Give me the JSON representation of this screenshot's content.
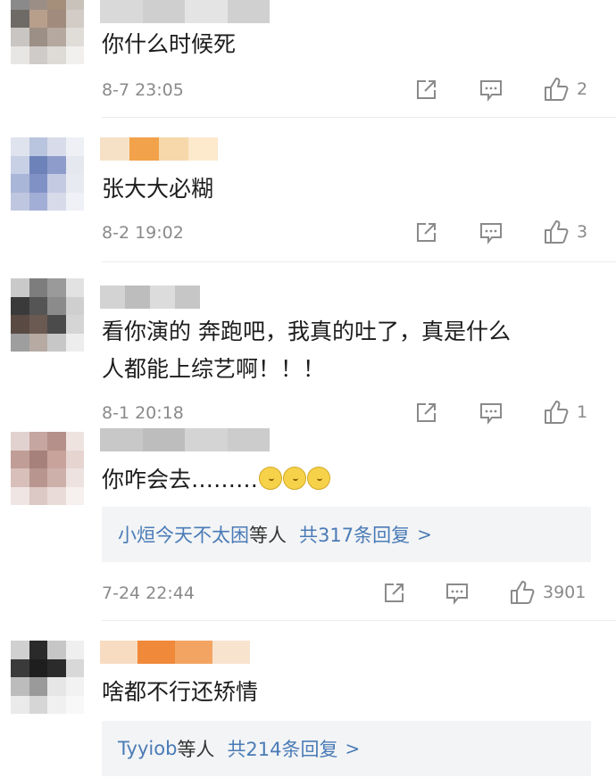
{
  "comments": [
    {
      "text": "你什么时候死",
      "time": "8-7 23:05",
      "likes": "2",
      "avatar_colors": [
        "#8a8a8a",
        "#9b8e86",
        "#a58f7a",
        "#c9c2bb",
        "#6e6a66",
        "#b89f8c",
        "#a08b7c",
        "#d3ccc6",
        "#c9c5c2",
        "#9c8f86",
        "#b5a89e",
        "#e0dcd8",
        "#e8e6e4",
        "#cfcbc8",
        "#dedad6",
        "#f2f0ee"
      ],
      "nick_colors": [
        "#d9d9d9",
        "#cfcfcf",
        "#e4e4e4",
        "#d0d0d0"
      ]
    },
    {
      "text": "张大大必糊",
      "time": "8-2 19:02",
      "likes": "3",
      "avatar_colors": [
        "#dfe3ee",
        "#b9c4de",
        "#d8dcea",
        "#eef0f6",
        "#c8d0e6",
        "#6d82b8",
        "#8e9ccc",
        "#e6e8f0",
        "#aab6d8",
        "#8091c5",
        "#c3cae2",
        "#e8eaf2",
        "#bfc6df",
        "#a3aed6",
        "#d6dae9",
        "#eff1f6"
      ],
      "nick_colors": [
        "#f6e1c6",
        "#f2a24a",
        "#f7d8aa",
        "#fde9cc"
      ]
    },
    {
      "text_lines": [
        "看你演的 奔跑吧，我真的吐了，真是什么",
        "人都能上综艺啊！！！"
      ],
      "time": "8-1 20:18",
      "likes": "1",
      "avatar_colors": [
        "#c9c9c9",
        "#7d7d7d",
        "#9a9a9a",
        "#e2e2e2",
        "#3a3a3a",
        "#555555",
        "#8b8b8b",
        "#cfcfcf",
        "#5a4a44",
        "#6a5a52",
        "#4b4b4b",
        "#d5d5d5",
        "#9e9e9e",
        "#b6aaa3",
        "#c7c7c7",
        "#ededed"
      ],
      "nick_colors": [
        "#d3d3d3",
        "#bdbdbd",
        "#dcdcdc",
        "#c6c6c6"
      ]
    },
    {
      "text": "你咋会去………",
      "emoji_count": 3,
      "replies_names": "小烜今天不太困",
      "replies_suffix": "等人",
      "replies_total": "共317条回复",
      "replies_chevron": ">",
      "time": "7-24 22:44",
      "likes": "3901",
      "avatar_colors": [
        "#e2d2cf",
        "#c6a6a0",
        "#b58f8a",
        "#efe3e0",
        "#c09d97",
        "#a6807b",
        "#c8a39c",
        "#e6d4d0",
        "#d8bfba",
        "#b8968f",
        "#cdb0aa",
        "#ede2df",
        "#efe5e3",
        "#dcc8c4",
        "#e8dbd8",
        "#f6f0ee"
      ],
      "nick_colors": [
        "#c8c8c8",
        "#bdbdbd",
        "#d4d4d4",
        "#cccccc"
      ]
    },
    {
      "text": "啥都不行还矫情",
      "replies_names": "Tyyiob",
      "replies_suffix": "等人",
      "replies_total": "共214条回复",
      "replies_chevron": ">",
      "avatar_colors": [
        "#d0d0d0",
        "#2a2a2a",
        "#c6c6c6",
        "#efefef",
        "#3a3a3a",
        "#1e1e1e",
        "#2b2b2b",
        "#d8d8d8",
        "#bcbcbc",
        "#9a9a9a",
        "#e6e6e6",
        "#f2f2f2",
        "#eaeaea",
        "#d6d6d6",
        "#f0f0f0",
        "#f8f8f8"
      ],
      "nick_colors": [
        "#f7dcc1",
        "#f0893a",
        "#f3a463",
        "#f8e3cf"
      ]
    }
  ],
  "icons": {
    "share": "share-icon",
    "comment": "comment-icon",
    "like": "like-icon"
  }
}
